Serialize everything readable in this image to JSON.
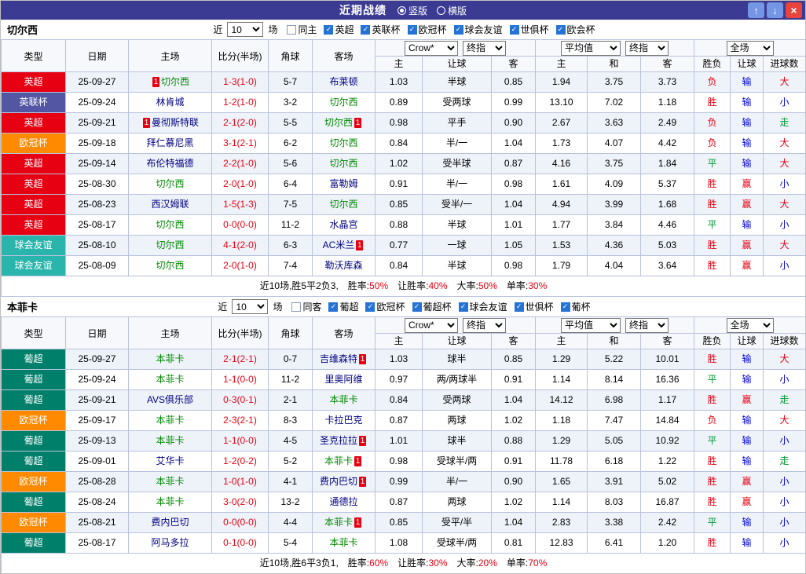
{
  "titlebar": {
    "title": "近期战绩",
    "radios": [
      {
        "label": "竖版",
        "selected": true
      },
      {
        "label": "横版",
        "selected": false
      }
    ],
    "up_icon": "↑",
    "down_icon": "↓",
    "close_icon": "×"
  },
  "filter_prefix": "近",
  "filter_suffix": "场",
  "colors": {
    "titlebar_bg": "#3b3b93",
    "subject_team": "#008800",
    "opponent_team": "#000080",
    "score": "#e60012"
  },
  "league_colors": {
    "英超": "#e60012",
    "英联杯": "#5356a2",
    "欧冠杯": "#ff8a00",
    "球会友谊": "#2ab5ac",
    "葡超": "#00806b"
  },
  "result_colors": {
    "胜": "#e60012",
    "平": "#009933",
    "负": "#e60012",
    "赢": "#e60012",
    "输": "#0000dd",
    "大": "#e60012",
    "小": "#0000dd",
    "走": "#009933"
  },
  "sections": [
    {
      "team": "切尔西",
      "recent_value": "10",
      "checkboxes": [
        {
          "label": "同主",
          "checked": false
        },
        {
          "label": "英超",
          "checked": true
        },
        {
          "label": "英联杯",
          "checked": true
        },
        {
          "label": "欧冠杯",
          "checked": true
        },
        {
          "label": "球会友谊",
          "checked": true
        },
        {
          "label": "世俱杯",
          "checked": true
        },
        {
          "label": "欧会杯",
          "checked": true
        }
      ],
      "selects": [
        "Crow*",
        "终指",
        "平均值",
        "终指",
        "全场"
      ],
      "columns": [
        "类型",
        "日期",
        "主场",
        "比分(半场)",
        "角球",
        "客场",
        "主",
        "让球",
        "客",
        "主",
        "和",
        "客",
        "胜负",
        "让球",
        "进球数"
      ],
      "rows": [
        {
          "league": "英超",
          "date": "25-09-27",
          "home": "切尔西",
          "home_subject": true,
          "home_card": "1",
          "score": "1-3(1-0)",
          "corners": "5-7",
          "away": "布莱顿",
          "away_subject": false,
          "away_card": "",
          "ah": [
            "1.03",
            "半球",
            "0.85"
          ],
          "eu": [
            "1.94",
            "3.75",
            "3.73"
          ],
          "results": [
            "负",
            "输",
            "大"
          ]
        },
        {
          "league": "英联杯",
          "date": "25-09-24",
          "home": "林肯城",
          "home_subject": false,
          "home_card": "",
          "score": "1-2(1-0)",
          "corners": "3-2",
          "away": "切尔西",
          "away_subject": true,
          "away_card": "",
          "ah": [
            "0.89",
            "受两球",
            "0.99"
          ],
          "eu": [
            "13.10",
            "7.02",
            "1.18"
          ],
          "results": [
            "胜",
            "输",
            "小"
          ]
        },
        {
          "league": "英超",
          "date": "25-09-21",
          "home": "曼彻斯特联",
          "home_subject": false,
          "home_card": "1",
          "score": "2-1(2-0)",
          "corners": "5-5",
          "away": "切尔西",
          "away_subject": true,
          "away_card": "1",
          "ah": [
            "0.98",
            "平手",
            "0.90"
          ],
          "eu": [
            "2.67",
            "3.63",
            "2.49"
          ],
          "results": [
            "负",
            "输",
            "走"
          ]
        },
        {
          "league": "欧冠杯",
          "date": "25-09-18",
          "home": "拜仁慕尼黑",
          "home_subject": false,
          "home_card": "",
          "score": "3-1(2-1)",
          "corners": "6-2",
          "away": "切尔西",
          "away_subject": true,
          "away_card": "",
          "ah": [
            "0.84",
            "半/一",
            "1.04"
          ],
          "eu": [
            "1.73",
            "4.07",
            "4.42"
          ],
          "results": [
            "负",
            "输",
            "大"
          ]
        },
        {
          "league": "英超",
          "date": "25-09-14",
          "home": "布伦特福德",
          "home_subject": false,
          "home_card": "",
          "score": "2-2(1-0)",
          "corners": "5-6",
          "away": "切尔西",
          "away_subject": true,
          "away_card": "",
          "ah": [
            "1.02",
            "受半球",
            "0.87"
          ],
          "eu": [
            "4.16",
            "3.75",
            "1.84"
          ],
          "results": [
            "平",
            "输",
            "大"
          ]
        },
        {
          "league": "英超",
          "date": "25-08-30",
          "home": "切尔西",
          "home_subject": true,
          "home_card": "",
          "score": "2-0(1-0)",
          "corners": "6-4",
          "away": "富勒姆",
          "away_subject": false,
          "away_card": "",
          "ah": [
            "0.91",
            "半/一",
            "0.98"
          ],
          "eu": [
            "1.61",
            "4.09",
            "5.37"
          ],
          "results": [
            "胜",
            "赢",
            "小"
          ]
        },
        {
          "league": "英超",
          "date": "25-08-23",
          "home": "西汉姆联",
          "home_subject": false,
          "home_card": "",
          "score": "1-5(1-3)",
          "corners": "7-5",
          "away": "切尔西",
          "away_subject": true,
          "away_card": "",
          "ah": [
            "0.85",
            "受半/一",
            "1.04"
          ],
          "eu": [
            "4.94",
            "3.99",
            "1.68"
          ],
          "results": [
            "胜",
            "赢",
            "大"
          ]
        },
        {
          "league": "英超",
          "date": "25-08-17",
          "home": "切尔西",
          "home_subject": true,
          "home_card": "",
          "score": "0-0(0-0)",
          "corners": "11-2",
          "away": "水晶宫",
          "away_subject": false,
          "away_card": "",
          "ah": [
            "0.88",
            "半球",
            "1.01"
          ],
          "eu": [
            "1.77",
            "3.84",
            "4.46"
          ],
          "results": [
            "平",
            "输",
            "小"
          ]
        },
        {
          "league": "球会友谊",
          "date": "25-08-10",
          "home": "切尔西",
          "home_subject": true,
          "home_card": "",
          "score": "4-1(2-0)",
          "corners": "6-3",
          "away": "AC米兰",
          "away_subject": false,
          "away_card": "1",
          "ah": [
            "0.77",
            "一球",
            "1.05"
          ],
          "eu": [
            "1.53",
            "4.36",
            "5.03"
          ],
          "results": [
            "胜",
            "赢",
            "大"
          ]
        },
        {
          "league": "球会友谊",
          "date": "25-08-09",
          "home": "切尔西",
          "home_subject": true,
          "home_card": "",
          "score": "2-0(1-0)",
          "corners": "7-4",
          "away": "勒沃库森",
          "away_subject": false,
          "away_card": "",
          "ah": [
            "0.84",
            "半球",
            "0.98"
          ],
          "eu": [
            "1.79",
            "4.04",
            "3.64"
          ],
          "results": [
            "胜",
            "赢",
            "小"
          ]
        }
      ],
      "summary_prefix": "近10场,胜5平2负3,",
      "summary_stats": [
        {
          "label": "胜率:",
          "value": "50%"
        },
        {
          "label": "让胜率:",
          "value": "40%"
        },
        {
          "label": "大率:",
          "value": "50%"
        },
        {
          "label": "单率:",
          "value": "30%"
        }
      ]
    },
    {
      "team": "本菲卡",
      "recent_value": "10",
      "checkboxes": [
        {
          "label": "同客",
          "checked": false
        },
        {
          "label": "葡超",
          "checked": true
        },
        {
          "label": "欧冠杯",
          "checked": true
        },
        {
          "label": "葡超杯",
          "checked": true
        },
        {
          "label": "球会友谊",
          "checked": true
        },
        {
          "label": "世俱杯",
          "checked": true
        },
        {
          "label": "葡杯",
          "checked": true
        }
      ],
      "selects": [
        "Crow*",
        "终指",
        "平均值",
        "终指",
        "全场"
      ],
      "columns": [
        "类型",
        "日期",
        "主场",
        "比分(半场)",
        "角球",
        "客场",
        "主",
        "让球",
        "客",
        "主",
        "和",
        "客",
        "胜负",
        "让球",
        "进球数"
      ],
      "rows": [
        {
          "league": "葡超",
          "date": "25-09-27",
          "home": "本菲卡",
          "home_subject": true,
          "home_card": "",
          "score": "2-1(2-1)",
          "corners": "0-7",
          "away": "吉维森特",
          "away_subject": false,
          "away_card": "1",
          "ah": [
            "1.03",
            "球半",
            "0.85"
          ],
          "eu": [
            "1.29",
            "5.22",
            "10.01"
          ],
          "results": [
            "胜",
            "输",
            "大"
          ]
        },
        {
          "league": "葡超",
          "date": "25-09-24",
          "home": "本菲卡",
          "home_subject": true,
          "home_card": "",
          "score": "1-1(0-0)",
          "corners": "11-2",
          "away": "里奥阿维",
          "away_subject": false,
          "away_card": "",
          "ah": [
            "0.97",
            "两/两球半",
            "0.91"
          ],
          "eu": [
            "1.14",
            "8.14",
            "16.36"
          ],
          "results": [
            "平",
            "输",
            "小"
          ]
        },
        {
          "league": "葡超",
          "date": "25-09-21",
          "home": "AVS俱乐部",
          "home_subject": false,
          "home_card": "",
          "score": "0-3(0-1)",
          "corners": "2-1",
          "away": "本菲卡",
          "away_subject": true,
          "away_card": "",
          "ah": [
            "0.84",
            "受两球",
            "1.04"
          ],
          "eu": [
            "14.12",
            "6.98",
            "1.17"
          ],
          "results": [
            "胜",
            "赢",
            "走"
          ]
        },
        {
          "league": "欧冠杯",
          "date": "25-09-17",
          "home": "本菲卡",
          "home_subject": true,
          "home_card": "",
          "score": "2-3(2-1)",
          "corners": "8-3",
          "away": "卡拉巴克",
          "away_subject": false,
          "away_card": "",
          "ah": [
            "0.87",
            "两球",
            "1.02"
          ],
          "eu": [
            "1.18",
            "7.47",
            "14.84"
          ],
          "results": [
            "负",
            "输",
            "大"
          ]
        },
        {
          "league": "葡超",
          "date": "25-09-13",
          "home": "本菲卡",
          "home_subject": true,
          "home_card": "",
          "score": "1-1(0-0)",
          "corners": "4-5",
          "away": "圣克拉拉",
          "away_subject": false,
          "away_card": "1",
          "ah": [
            "1.01",
            "球半",
            "0.88"
          ],
          "eu": [
            "1.29",
            "5.05",
            "10.92"
          ],
          "results": [
            "平",
            "输",
            "小"
          ]
        },
        {
          "league": "葡超",
          "date": "25-09-01",
          "home": "艾华卡",
          "home_subject": false,
          "home_card": "",
          "score": "1-2(0-2)",
          "corners": "5-2",
          "away": "本菲卡",
          "away_subject": true,
          "away_card": "1",
          "ah": [
            "0.98",
            "受球半/两",
            "0.91"
          ],
          "eu": [
            "11.78",
            "6.18",
            "1.22"
          ],
          "results": [
            "胜",
            "输",
            "走"
          ]
        },
        {
          "league": "欧冠杯",
          "date": "25-08-28",
          "home": "本菲卡",
          "home_subject": true,
          "home_card": "",
          "score": "1-0(1-0)",
          "corners": "4-1",
          "away": "费内巴切",
          "away_subject": false,
          "away_card": "1",
          "ah": [
            "0.99",
            "半/一",
            "0.90"
          ],
          "eu": [
            "1.65",
            "3.91",
            "5.02"
          ],
          "results": [
            "胜",
            "赢",
            "小"
          ]
        },
        {
          "league": "葡超",
          "date": "25-08-24",
          "home": "本菲卡",
          "home_subject": true,
          "home_card": "",
          "score": "3-0(2-0)",
          "corners": "13-2",
          "away": "通德拉",
          "away_subject": false,
          "away_card": "",
          "ah": [
            "0.87",
            "两球",
            "1.02"
          ],
          "eu": [
            "1.14",
            "8.03",
            "16.87"
          ],
          "results": [
            "胜",
            "赢",
            "小"
          ]
        },
        {
          "league": "欧冠杯",
          "date": "25-08-21",
          "home": "费内巴切",
          "home_subject": false,
          "home_card": "",
          "score": "0-0(0-0)",
          "corners": "4-4",
          "away": "本菲卡",
          "away_subject": true,
          "away_card": "1",
          "ah": [
            "0.85",
            "受平/半",
            "1.04"
          ],
          "eu": [
            "2.83",
            "3.38",
            "2.42"
          ],
          "results": [
            "平",
            "输",
            "小"
          ]
        },
        {
          "league": "葡超",
          "date": "25-08-17",
          "home": "阿马多拉",
          "home_subject": false,
          "home_card": "",
          "score": "0-1(0-0)",
          "corners": "5-4",
          "away": "本菲卡",
          "away_subject": true,
          "away_card": "",
          "ah": [
            "1.08",
            "受球半/两",
            "0.81"
          ],
          "eu": [
            "12.83",
            "6.41",
            "1.20"
          ],
          "results": [
            "胜",
            "输",
            "小"
          ]
        }
      ],
      "summary_prefix": "近10场,胜6平3负1,",
      "summary_stats": [
        {
          "label": "胜率:",
          "value": "60%"
        },
        {
          "label": "让胜率:",
          "value": "30%"
        },
        {
          "label": "大率:",
          "value": "20%"
        },
        {
          "label": "单率:",
          "value": "70%"
        }
      ]
    }
  ]
}
